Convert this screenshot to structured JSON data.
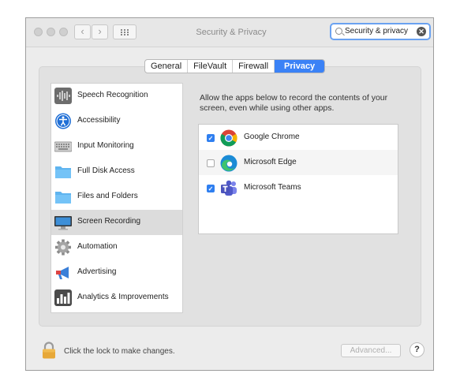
{
  "window": {
    "title": "Security & Privacy"
  },
  "search": {
    "value": "Security & privacy"
  },
  "toolbar": {
    "back_label": "‹",
    "forward_label": "›"
  },
  "tabs": [
    {
      "label": "General",
      "active": false
    },
    {
      "label": "FileVault",
      "active": false
    },
    {
      "label": "Firewall",
      "active": false
    },
    {
      "label": "Privacy",
      "active": true
    }
  ],
  "sidebar": {
    "items": [
      {
        "label": "Speech Recognition",
        "icon": "speech-recognition-icon",
        "selected": false
      },
      {
        "label": "Accessibility",
        "icon": "accessibility-icon",
        "selected": false
      },
      {
        "label": "Input Monitoring",
        "icon": "keyboard-icon",
        "selected": false
      },
      {
        "label": "Full Disk Access",
        "icon": "folder-icon",
        "selected": false
      },
      {
        "label": "Files and Folders",
        "icon": "folder-icon",
        "selected": false
      },
      {
        "label": "Screen Recording",
        "icon": "display-icon",
        "selected": true
      },
      {
        "label": "Automation",
        "icon": "gear-icon",
        "selected": false
      },
      {
        "label": "Advertising",
        "icon": "megaphone-icon",
        "selected": false
      },
      {
        "label": "Analytics & Improvements",
        "icon": "bar-chart-icon",
        "selected": false
      }
    ]
  },
  "main": {
    "description": "Allow the apps below to record the contents of your screen, even while using other apps.",
    "apps": [
      {
        "name": "Google Chrome",
        "checked": true,
        "icon": "chrome-icon"
      },
      {
        "name": "Microsoft Edge",
        "checked": false,
        "icon": "edge-icon"
      },
      {
        "name": "Microsoft Teams",
        "checked": true,
        "icon": "teams-icon"
      }
    ]
  },
  "footer": {
    "lock_text": "Click the lock to make changes.",
    "advanced_label": "Advanced...",
    "help_label": "?"
  },
  "colors": {
    "accent": "#3b82f6",
    "checkbox": "#2f7ff0",
    "selected_row": "#dcdcdc"
  }
}
